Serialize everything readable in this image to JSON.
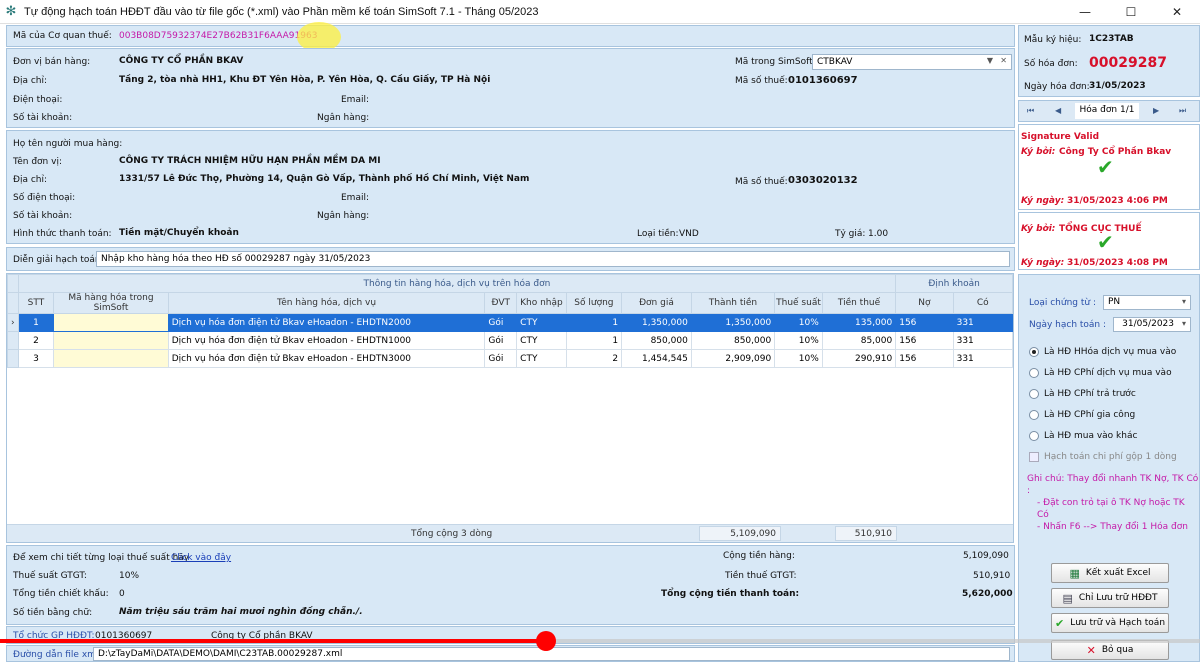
{
  "window": {
    "title": "Tự động hạch toán HĐĐT đầu vào từ file gốc (*.xml) vào Phần mềm kế toán SimSoft 7.1 - Tháng 05/2023",
    "minimize": "—",
    "maximize": "☐",
    "close": "✕"
  },
  "tax_code": {
    "label": "Mã của Cơ quan thuế:",
    "value": "003B08D75932374E27B62B31F6AAA91963"
  },
  "seller": {
    "name_label": "Đơn vị bán hàng:",
    "name": "CÔNG TY CỔ PHẦN BKAV",
    "address_label": "Địa chỉ:",
    "address": "Tầng 2, tòa nhà HH1, Khu ĐT Yên Hòa, P. Yên Hòa, Q. Cầu Giấy, TP Hà Nội",
    "phone_label": "Điện thoại:",
    "email_label": "Email:",
    "account_label": "Số tài khoản:",
    "bank_label": "Ngân hàng:",
    "simsoft_code_label": "Mã trong SimSoft:",
    "simsoft_code": "CTBKAV",
    "tax_id_label": "Mã số thuế:",
    "tax_id": "0101360697"
  },
  "buyer": {
    "person_label": "Họ tên người mua hàng:",
    "unit_label": "Tên đơn vị:",
    "unit": "CÔNG TY TRÁCH NHIỆM HỮU HẠN PHẦN MỀM DA MI",
    "address_label": "Địa chỉ:",
    "address": "1331/57 Lê Đức Thọ, Phường 14, Quận Gò Vấp, Thành phố Hồ Chí Minh, Việt Nam",
    "tax_id_label": "Mã số thuế:",
    "tax_id": "0303020132",
    "phone_label": "Số điện thoại:",
    "email_label": "Email:",
    "account_label": "Số tài khoản:",
    "bank_label": "Ngân hàng:",
    "payment_label": "Hình thức thanh toán:",
    "payment": "Tiền mặt/Chuyển khoản",
    "currency_label": "Loại tiền:",
    "currency": "VND",
    "rate_label": "Tỷ giá:",
    "rate": "1.00"
  },
  "explanation": {
    "label": "Diễn giải hạch toán :",
    "value": "Nhập kho hàng hóa theo HĐ số 00029287 ngày 31/05/2023"
  },
  "invoice": {
    "symbol_label": "Mẫu ký hiệu:",
    "symbol": "1C23TAB",
    "number_label": "Số hóa đơn:",
    "number": "00029287",
    "date_label": "Ngày hóa đơn:",
    "date": "31/05/2023",
    "nav_label": "Hóa đơn 1/1"
  },
  "signature1": {
    "status": "Signature Valid",
    "by_label": "Ký bởi:",
    "by": "Công Ty Cổ Phần Bkav",
    "date_label": "Ký ngày:",
    "date": "31/05/2023 4:06 PM"
  },
  "signature2": {
    "by_label": "Ký bởi:",
    "by": "TỔNG CỤC THUẾ",
    "date_label": "Ký ngày:",
    "date": "31/05/2023 4:08 PM"
  },
  "grid": {
    "group1": "Thông tin hàng hóa, dịch vụ trên hóa đơn",
    "group2": "Định khoản",
    "headers": [
      "STT",
      "Mã hàng hóa trong SimSoft",
      "Tên hàng hóa, dịch vụ",
      "ĐVT",
      "Kho nhập",
      "Số lượng",
      "Đơn giá",
      "Thành tiền",
      "Thuế suất",
      "Tiền thuế",
      "Nợ",
      "Có"
    ],
    "rows": [
      [
        "1",
        "",
        "Dịch vụ hóa đơn điện tử Bkav eHoadon - EHDTN2000",
        "Gói",
        "CTY",
        "1",
        "1,350,000",
        "1,350,000",
        "10%",
        "135,000",
        "156",
        "331"
      ],
      [
        "2",
        "",
        "Dịch vụ hóa đơn điện tử Bkav eHoadon - EHDTN1000",
        "Gói",
        "CTY",
        "1",
        "850,000",
        "850,000",
        "10%",
        "85,000",
        "156",
        "331"
      ],
      [
        "3",
        "",
        "Dịch vụ hóa đơn điện tử Bkav eHoadon - EHDTN3000",
        "Gói",
        "CTY",
        "2",
        "1,454,545",
        "2,909,090",
        "10%",
        "290,910",
        "156",
        "331"
      ]
    ],
    "footer_label": "Tổng cộng 3 dòng",
    "footer_amount": "5,109,090",
    "footer_tax": "510,910"
  },
  "totals": {
    "detail_text": "Để xem chi tiết từng loại thuế suất hãy",
    "detail_link": "Click vào đây",
    "vat_rate_label": "Thuế suất GTGT:",
    "vat_rate": "10%",
    "discount_label": "Tổng tiền chiết khấu:",
    "discount": "0",
    "words_label": "Số tiền bằng chữ:",
    "words": "Năm triệu sáu trăm hai mươi nghìn đồng chẵn./.",
    "goods_label": "Cộng tiền hàng:",
    "goods": "5,109,090",
    "tax_label": "Tiền thuế GTGT:",
    "tax": "510,910",
    "grand_label": "Tổng cộng tiền thanh toán:",
    "grand": "5,620,000"
  },
  "provider": {
    "label": "Tổ chức GP HĐĐT:",
    "tax_id": "0101360697",
    "name": "Công ty Cổ phần BKAV"
  },
  "file": {
    "label": "Đường dẫn file xml:",
    "path": "D:\\zTayDaMi\\DATA\\DEMO\\DAMI\\C23TAB.00029287.xml"
  },
  "options": {
    "voucher_type_label": "Loại chứng từ :",
    "voucher_type": "PN",
    "post_date_label": "Ngày hạch toán :",
    "post_date": "31/05/2023",
    "radios": [
      "Là HĐ HHóa dịch vụ mua vào",
      "Là HĐ CPhí dịch vụ mua vào",
      "Là HĐ CPhí trả trước",
      "Là HĐ CPhí gia công",
      "Là HĐ mua vào khác"
    ],
    "checkbox": "Hạch toán chi phí gộp 1 dòng",
    "note": [
      "Ghi chú: Thay đổi nhanh TK Nợ, TK Có :",
      "- Đặt con trỏ tại ô TK Nợ hoặc TK Có",
      "- Nhấn F6 --> Thay đổi 1 Hóa đơn"
    ]
  },
  "buttons": {
    "export": "Kết xuất Excel",
    "save_only": "Chỉ Lưu trữ HĐĐT",
    "save_post": "Lưu trữ và Hạch toán",
    "skip": "Bỏ qua"
  },
  "video_progress": 0.455
}
